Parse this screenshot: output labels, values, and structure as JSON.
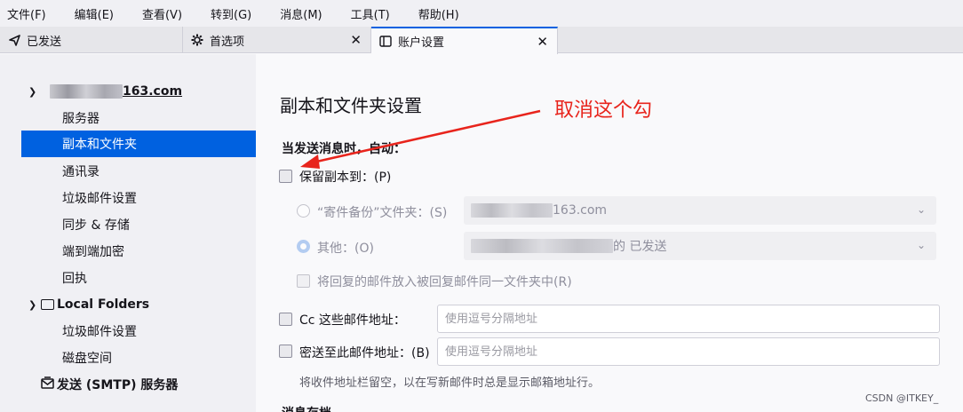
{
  "menu": [
    "文件(F)",
    "编辑(E)",
    "查看(V)",
    "转到(G)",
    "消息(M)",
    "工具(T)",
    "帮助(H)"
  ],
  "tabs": [
    {
      "label": "已发送",
      "icon": "send-icon",
      "active": false
    },
    {
      "label": "首选项",
      "icon": "gear-icon",
      "active": false,
      "close": "✕"
    },
    {
      "label": "账户设置",
      "icon": "account-settings-icon",
      "active": true,
      "close": "✕"
    }
  ],
  "sidebar": {
    "account_suffix": "163.com",
    "account_items": [
      "服务器",
      "副本和文件夹",
      "通讯录",
      "垃圾邮件设置",
      "同步 & 存储",
      "端到端加密",
      "回执"
    ],
    "selected_item": "副本和文件夹",
    "local_folders": "Local Folders",
    "local_items": [
      "垃圾邮件设置",
      "磁盘空间"
    ],
    "smtp": "发送 (SMTP) 服务器"
  },
  "content": {
    "title": "副本和文件夹设置",
    "annotation": "取消这个勾",
    "section_heading": "当发送消息时，自动：",
    "keep_copy_label": "保留副本到：(P)",
    "keep_copy_checked": false,
    "sent_folder_label": "“寄件备份”文件夹：(S)",
    "sent_folder_value": "163.com",
    "other_label": "其他：(O)",
    "other_value": "的 已发送",
    "other_checked": true,
    "reply_in_folder_label": "将回复的邮件放入被回复邮件同一文件夹中(R)",
    "cc_label": "Cc 这些邮件地址：",
    "cc_placeholder": "使用逗号分隔地址",
    "bcc_label": "密送至此邮件地址：(B)",
    "bcc_placeholder": "使用逗号分隔地址",
    "hint": "将收件地址栏留空，以在写新邮件时总是显示邮箱地址行。",
    "next_section_partial": "消息存档"
  },
  "watermark": "CSDN @ITKEY_",
  "colors": {
    "accent": "#0061e0",
    "annotation": "#e8241c"
  }
}
